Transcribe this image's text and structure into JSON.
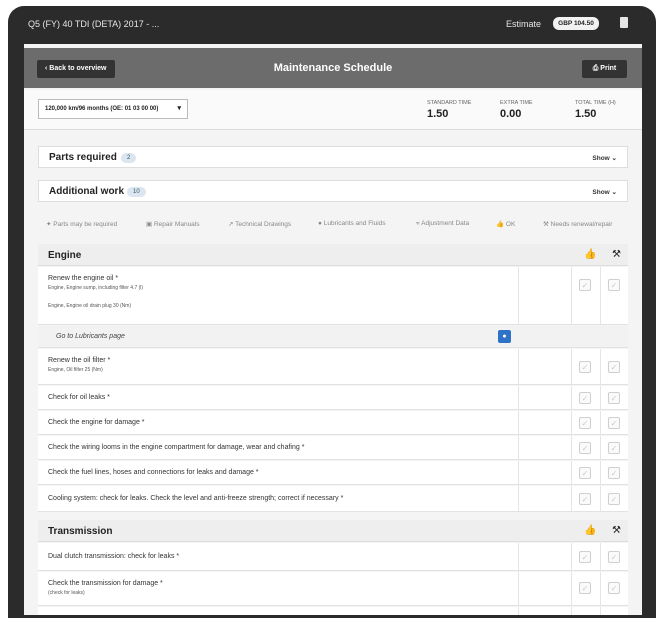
{
  "topbar": {
    "vehicle": "Q5 (FY) 40 TDI (DETA) 2017 - ...",
    "estimate_label": "Estimate",
    "estimate_badge": "GBP 104.50"
  },
  "header": {
    "back_label": "Back to overview",
    "title": "Maintenance Schedule",
    "print_label": "Print"
  },
  "interval": {
    "selected": "120,000 km/96 months (OE: 01 03 00 00)",
    "standard_time_label": "STANDARD TIME",
    "standard_time_value": "1.50",
    "extra_time_label": "EXTRA TIME",
    "extra_time_value": "0.00",
    "total_time_label": "TOTAL TIME (H)",
    "total_time_value": "1.50"
  },
  "parts_required": {
    "title": "Parts required",
    "count": "2",
    "show": "Show"
  },
  "additional_work": {
    "title": "Additional work",
    "count": "10",
    "show": "Show"
  },
  "legend": [
    {
      "icon": "parts-icon",
      "label": "Parts may be required"
    },
    {
      "icon": "manual-icon",
      "label": "Repair Manuals"
    },
    {
      "icon": "drawing-icon",
      "label": "Technical Drawings"
    },
    {
      "icon": "lubricant-icon",
      "label": "Lubricants and Fluids"
    },
    {
      "icon": "adjustment-icon",
      "label": "Adjustment Data"
    },
    {
      "icon": "thumbs-up-icon",
      "label": "OK"
    },
    {
      "icon": "wrench-icon",
      "label": "Needs renewal/repair"
    }
  ],
  "engine": {
    "title": "Engine",
    "rows": [
      {
        "line1": "Renew the engine oil *",
        "line2": "Engine,  Engine sump, including filter 4.7 (l)",
        "line3": "Engine,  Engine oil drain plug 30 (Nm)"
      },
      {
        "line1": "Renew the oil filter *",
        "line2": "Engine,  Oil filter 25 (Nm)"
      },
      {
        "line1": "Check for oil leaks *"
      },
      {
        "line1": "Check the engine for damage *"
      },
      {
        "line1": "Check the wiring looms in the engine compartment for damage, wear and chafing *"
      },
      {
        "line1": "Check the fuel lines, hoses and connections for leaks and damage *"
      },
      {
        "line1": "Cooling system: check for leaks. Check the level and anti-freeze strength; correct if necessary *"
      }
    ],
    "lubricants_link": "Go to Lubricants page"
  },
  "transmission": {
    "title": "Transmission",
    "rows": [
      {
        "line1": "Dual clutch transmission: check for leaks *"
      },
      {
        "line1": "Check the transmission for damage *",
        "line2": "(check for leaks)"
      }
    ]
  }
}
